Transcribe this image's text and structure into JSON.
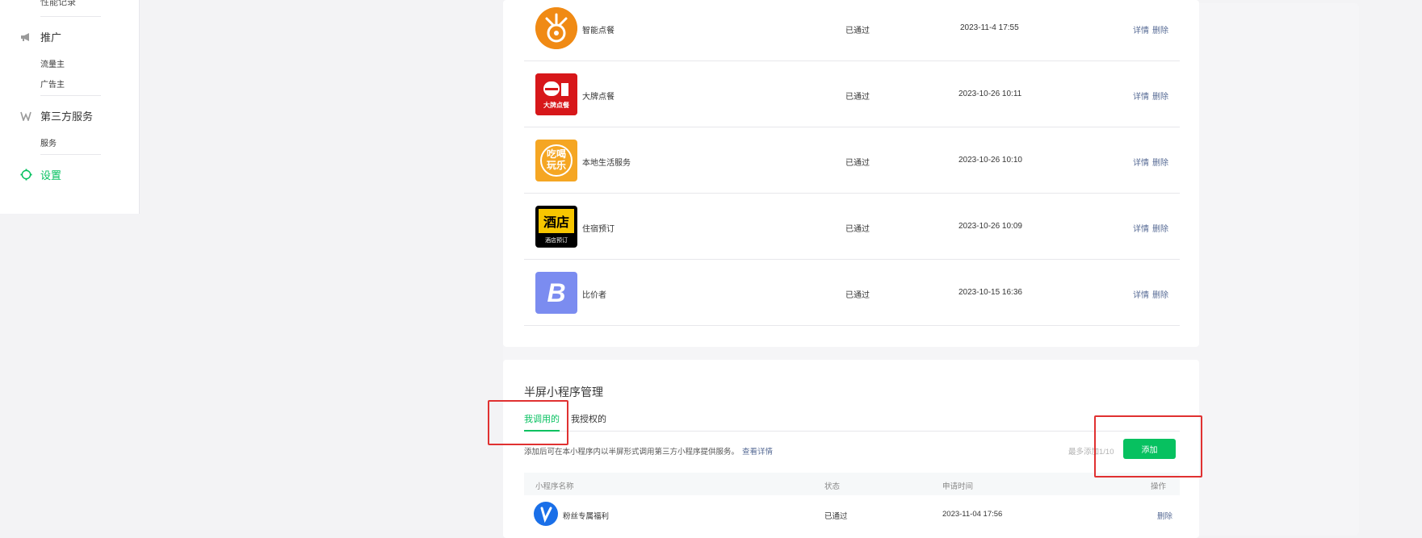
{
  "sidebar": {
    "cut_item": "性能记录",
    "promote": {
      "label": "推广",
      "items": [
        "流量主",
        "广告主"
      ]
    },
    "third_party": {
      "label": "第三方服务",
      "items": [
        "服务"
      ]
    },
    "settings": {
      "label": "设置"
    }
  },
  "apps": [
    {
      "name": "智能点餐",
      "status": "已通过",
      "time": "2023-11-4 17:55",
      "logo_text": "",
      "logo_bg": "#f08a14"
    },
    {
      "name": "大牌点餐",
      "status": "已通过",
      "time": "2023-10-26 10:11",
      "logo_text": "大牌点餐",
      "logo_bg": "#d7171a"
    },
    {
      "name": "本地生活服务",
      "status": "已通过",
      "time": "2023-10-26 10:10",
      "logo_text": "吃喝玩乐",
      "logo_bg": "#f5a623"
    },
    {
      "name": "住宿预订",
      "status": "已通过",
      "time": "2023-10-26 10:09",
      "logo_text": "酒店",
      "logo_sub": "酒店预订",
      "logo_bg": "#000000"
    },
    {
      "name": "比价者",
      "status": "已通过",
      "time": "2023-10-15 16:36",
      "logo_text": "B",
      "logo_bg": "#7b8cf0"
    }
  ],
  "ops": {
    "detail": "详情",
    "delete": "删除"
  },
  "half_screen": {
    "title": "半屏小程序管理",
    "tabs": [
      "我调用的",
      "我授权的"
    ],
    "desc": "添加后可在本小程序内以半屏形式调用第三方小程序提供服务。",
    "desc_link": "查看详情",
    "quota": "最多添加1/10",
    "add_button": "添加",
    "columns": {
      "name": "小程序名称",
      "status": "状态",
      "time": "申请时间",
      "ops": "操作"
    },
    "rows": [
      {
        "name": "粉丝专属福利",
        "status": "已通过",
        "time": "2023-11-04 17:56",
        "op": "删除"
      }
    ]
  },
  "colors": {
    "accent": "#07c160",
    "link": "#576b95",
    "highlight": "#e03131"
  }
}
